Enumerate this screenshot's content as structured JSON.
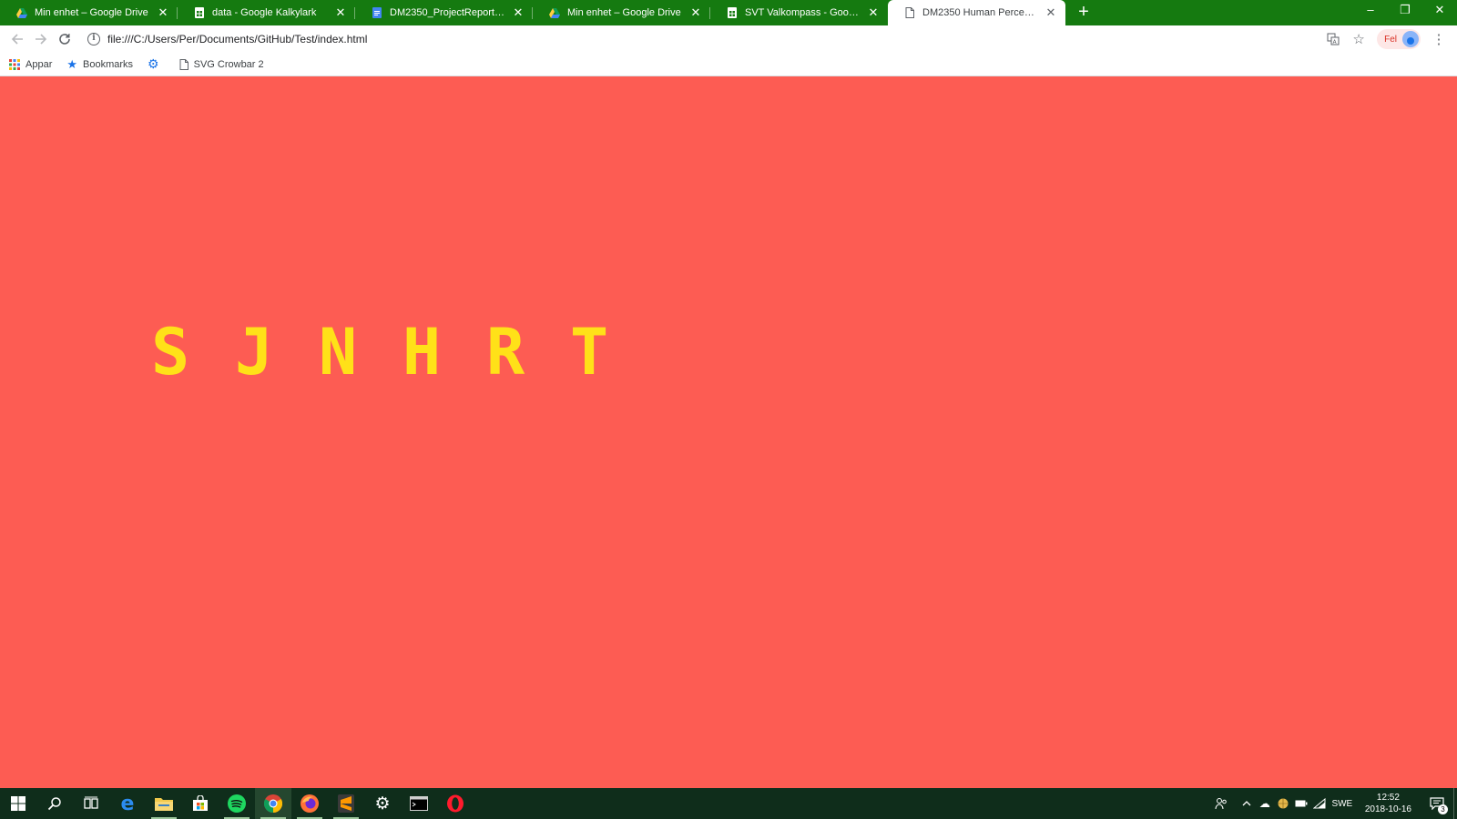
{
  "browser": {
    "tabs": [
      {
        "title": "Min enhet – Google Drive",
        "icon": "google-drive-icon",
        "active": false
      },
      {
        "title": "data - Google Kalkylark",
        "icon": "google-sheets-icon",
        "active": false
      },
      {
        "title": "DM2350_ProjectReport_PH3_2 - G",
        "icon": "google-docs-icon",
        "active": false
      },
      {
        "title": "Min enhet – Google Drive",
        "icon": "google-drive-icon",
        "active": false
      },
      {
        "title": "SVT Valkompass - Google Kalkylark",
        "icon": "google-sheets-icon",
        "active": false
      },
      {
        "title": "DM2350 Human Perception",
        "icon": "page-icon",
        "active": true
      }
    ],
    "new_tab_label": "+",
    "window_controls": {
      "minimize": "–",
      "restore": "❐",
      "close": "✕"
    },
    "url": "file:///C:/Users/Per/Documents/GitHub/Test/index.html",
    "profile_error_label": "Fel",
    "bookmarks": [
      {
        "label": "Appar",
        "icon": "apps-grid-icon"
      },
      {
        "label": "Bookmarks",
        "icon": "star-icon"
      },
      {
        "label": "",
        "icon": "gear-icon"
      },
      {
        "label": "SVG Crowbar 2",
        "icon": "page-icon"
      }
    ]
  },
  "page": {
    "background_color": "#fd5c53",
    "letter_color": "#ffe118",
    "letters": [
      "S",
      "J",
      "N",
      "H",
      "R",
      "T"
    ]
  },
  "taskbar": {
    "apps": [
      "start-icon",
      "search-icon",
      "task-view-icon",
      "edge-icon",
      "file-explorer-icon",
      "store-icon",
      "spotify-icon",
      "chrome-icon",
      "firefox-icon",
      "sublime-text-icon",
      "settings-icon",
      "terminal-icon",
      "opera-icon"
    ],
    "language": "SWE",
    "time": "12:52",
    "date": "2018-10-16",
    "notification_count": "3"
  }
}
